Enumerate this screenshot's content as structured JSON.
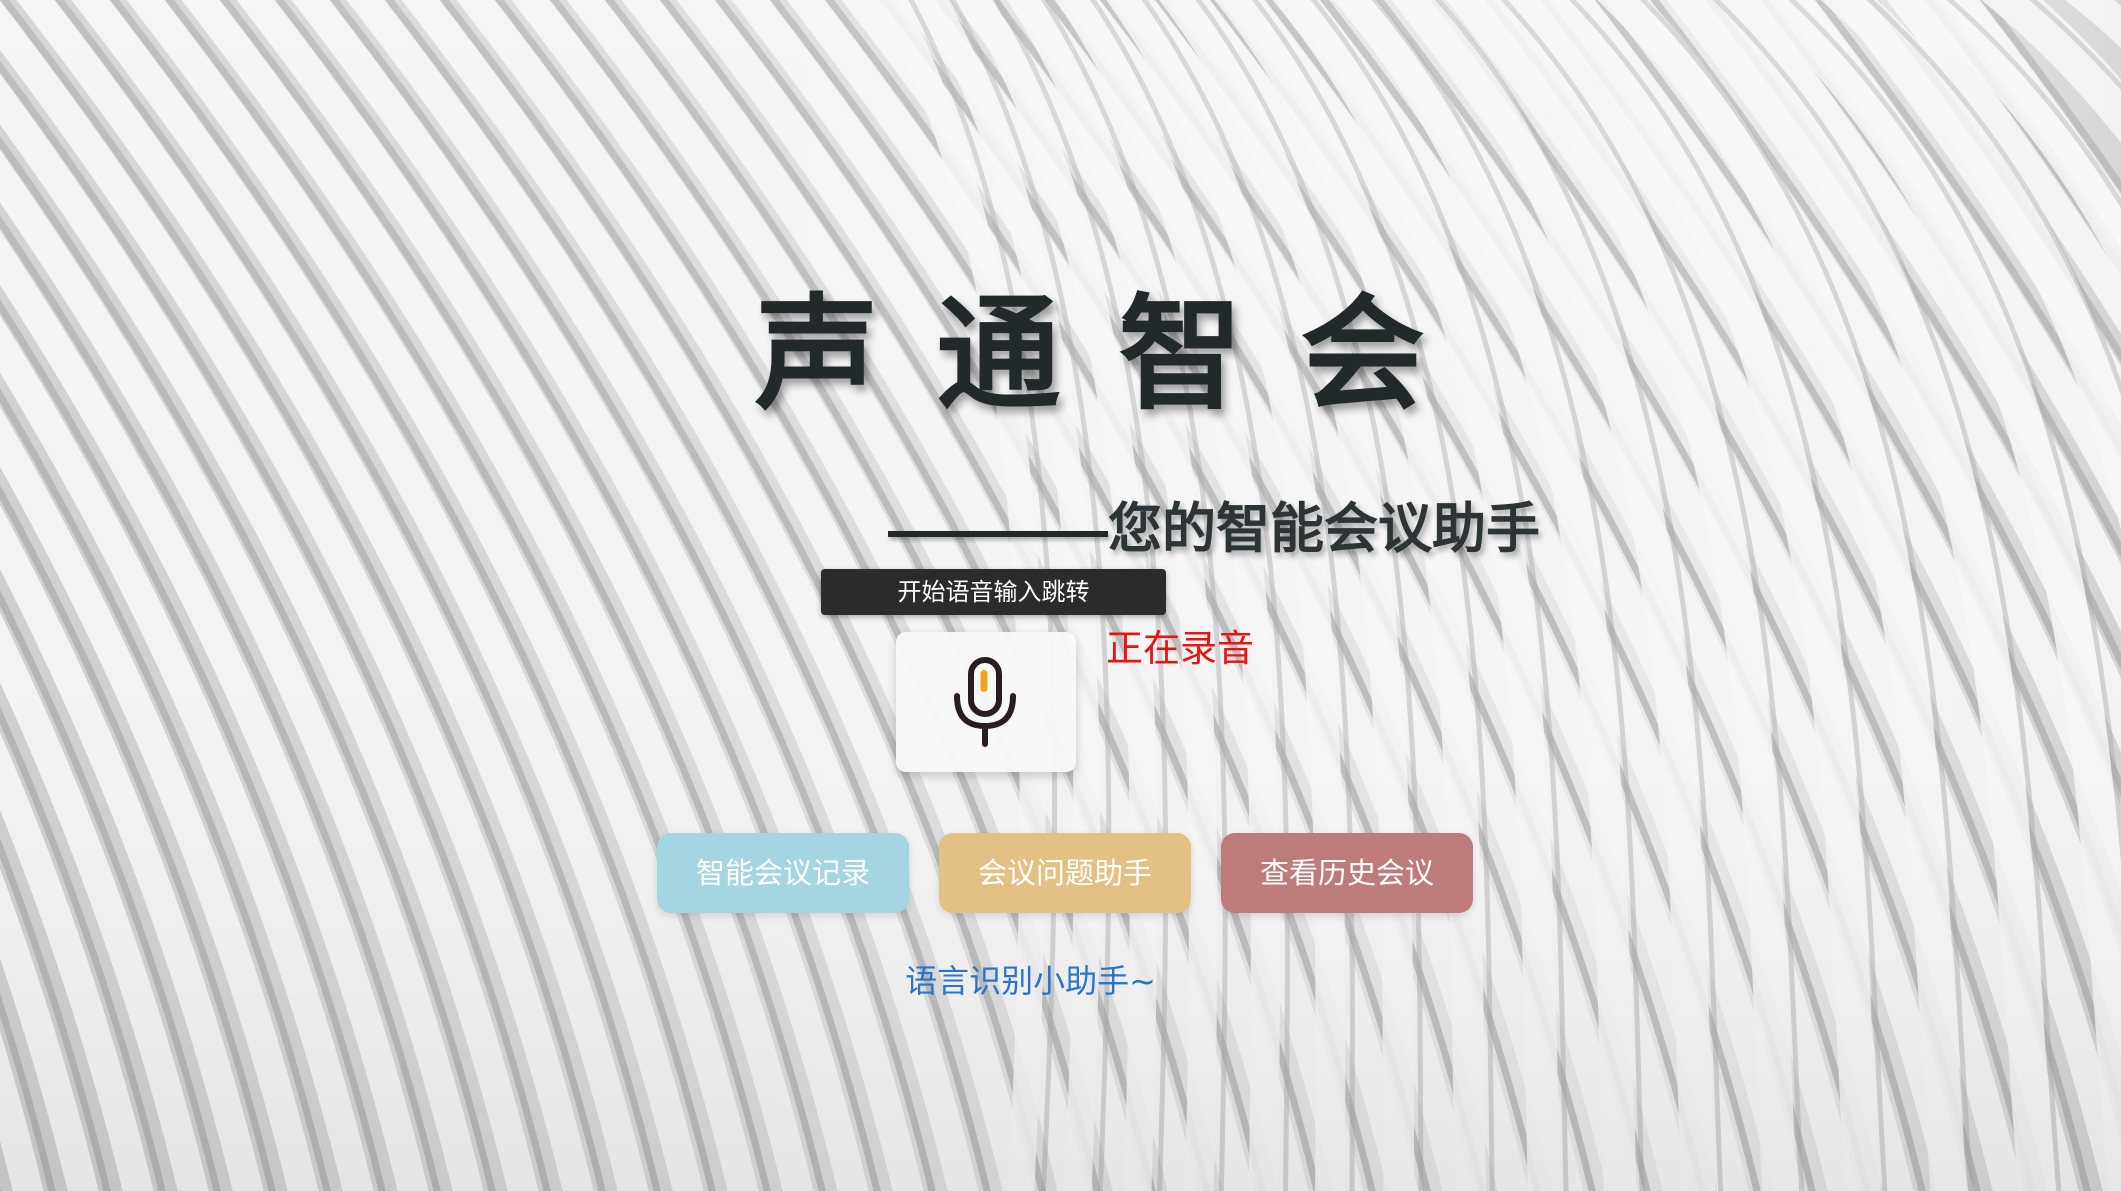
{
  "header": {
    "title": "声通智会",
    "subtitle_dash": "————",
    "subtitle": "您的智能会议助手"
  },
  "voice": {
    "start_label": "开始语音输入跳转",
    "status": "正在录音",
    "mic_icon": "microphone-icon"
  },
  "actions": [
    {
      "label": "智能会议记录",
      "color": "#a5d4e2"
    },
    {
      "label": "会议问题助手",
      "color": "#e3c184"
    },
    {
      "label": "查看历史会议",
      "color": "#bd7b7a"
    }
  ],
  "footer": {
    "helper_label": "语言识别小助手~"
  },
  "colors": {
    "title": "#22292b",
    "voice_bar": "#2b2b2b",
    "status": "#e81414",
    "helper_link": "#2a75c9",
    "mic_accent": "#f2a21b"
  }
}
